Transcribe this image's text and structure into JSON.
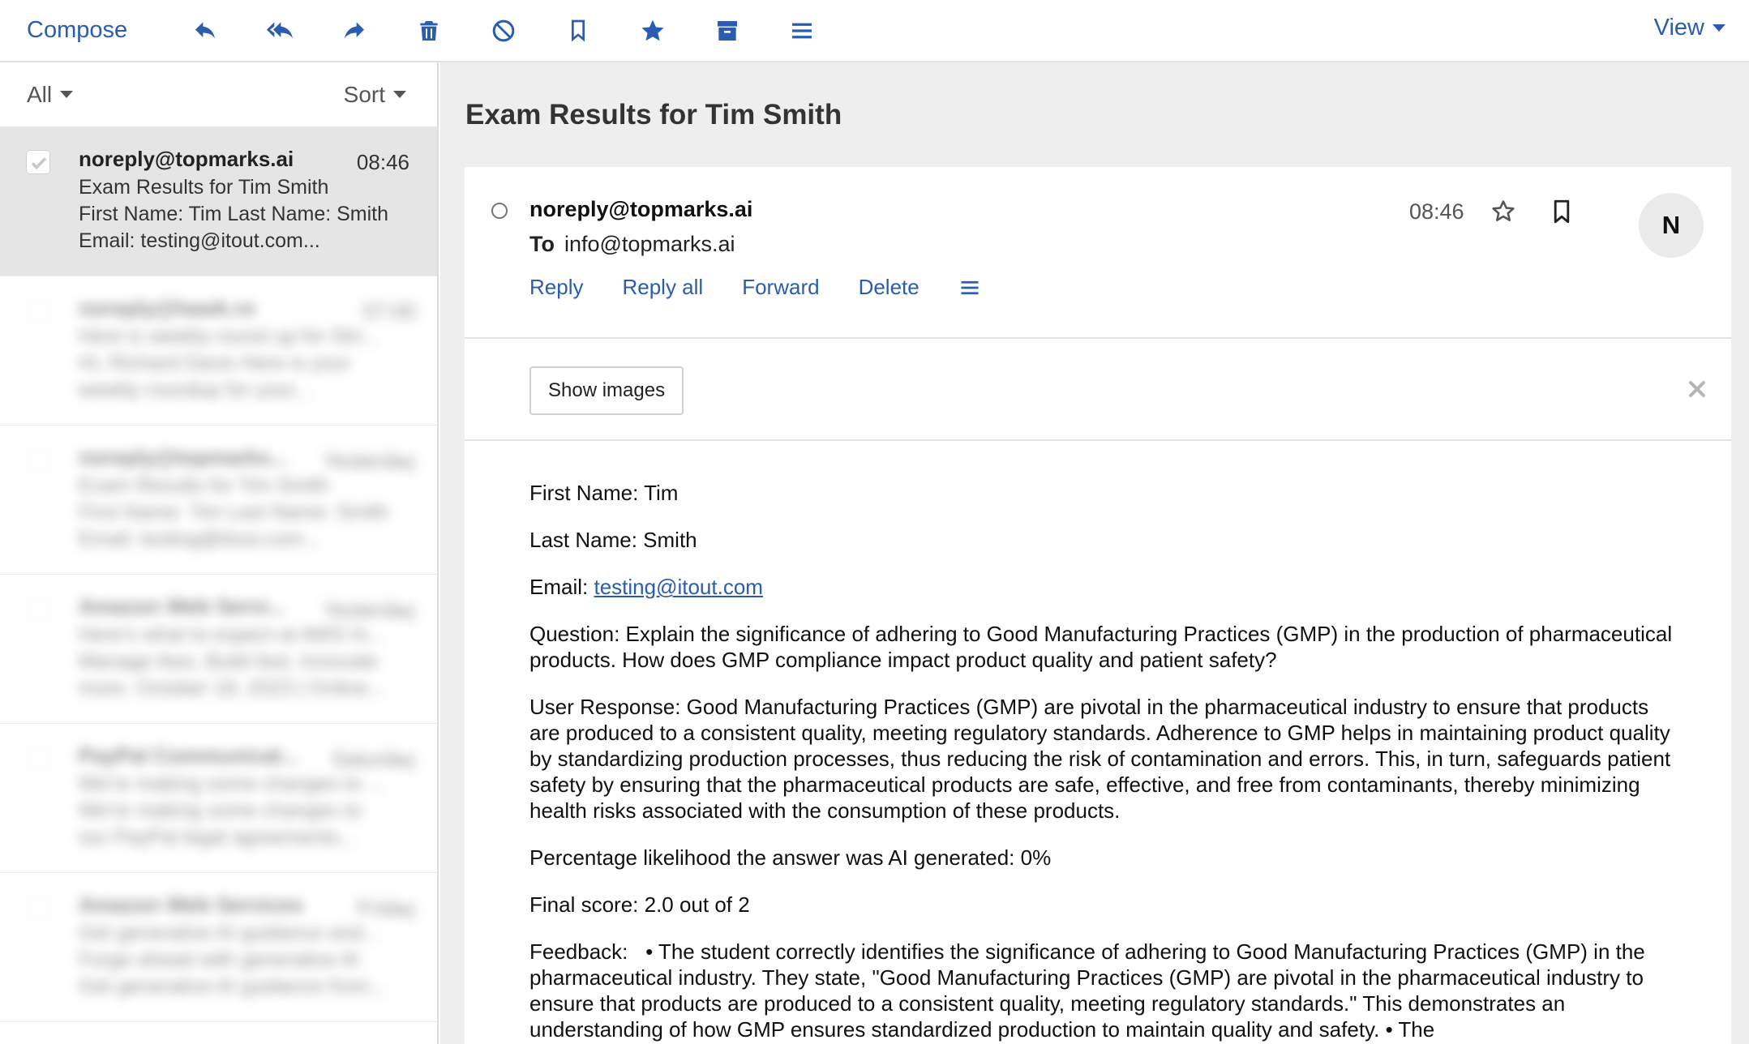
{
  "toolbar": {
    "compose_label": "Compose",
    "icons": [
      "reply-icon",
      "reply-all-icon",
      "forward-icon",
      "trash-icon",
      "block-icon",
      "bookmark-icon",
      "star-icon",
      "archive-icon",
      "menu-icon"
    ],
    "view_label": "View"
  },
  "sidebar": {
    "filter_label": "All",
    "sort_label": "Sort",
    "messages": [
      {
        "from": "noreply@topmarks.ai",
        "time": "08:46",
        "line1": "Exam Results for Tim Smith",
        "line2": "First Name: Tim Last Name: Smith",
        "line3": "Email: testing@itout.com..."
      },
      {
        "from": "noreply@hawk.ro",
        "time": "07:00",
        "line1": "Here is weekly round up for Stri...",
        "line2": "Hi, Richard Davis Here is your",
        "line3": "weekly roundup for your..."
      },
      {
        "from": "noreply@topmarks...",
        "time": "Yesterday",
        "line1": "Exam Results for Tim Smith",
        "line2": "First Name: Tim Last Name: Smith",
        "line3": "Email: testing@itout.com..."
      },
      {
        "from": "Amazon Web Servi...",
        "time": "Yesterday",
        "line1": "Here's what to expect at AWS In...",
        "line2": "Manage Aws, Build fast, Innovate",
        "line3": "more. October 18, 2023 | Online..."
      },
      {
        "from": "PayPal Communicat...",
        "time": "Saturday",
        "line1": "We're making some changes to ...",
        "line2": "We're making some changes to",
        "line3": "our PayPal legal agreements..."
      },
      {
        "from": "Amazon Web Services",
        "time": "Friday",
        "line1": "Get generative AI guidance and...",
        "line2": "Forge ahead with generative AI",
        "line3": "Get generative AI guidance from..."
      }
    ]
  },
  "email": {
    "subject": "Exam Results for Tim Smith",
    "sender": "noreply@topmarks.ai",
    "to_label": "To",
    "to": "info@topmarks.ai",
    "time": "08:46",
    "avatar_initial": "N",
    "actions": {
      "reply": "Reply",
      "reply_all": "Reply all",
      "forward": "Forward",
      "delete": "Delete"
    },
    "show_images_label": "Show images",
    "body": {
      "first_name": "First Name: Tim",
      "last_name": "Last Name: Smith",
      "email_prefix": "Email: ",
      "email_link": "testing@itout.com",
      "question": "Question: Explain the significance of adhering to Good Manufacturing Practices (GMP) in the production of pharmaceutical products. How does GMP compliance impact product quality and patient safety?",
      "user_response": "User Response: Good Manufacturing Practices (GMP) are pivotal in the pharmaceutical industry to ensure that products are produced to a consistent quality, meeting regulatory standards. Adherence to GMP helps in maintaining product quality by standardizing production processes, thus reducing the risk of contamination and errors. This, in turn, safeguards patient safety by ensuring that the pharmaceutical products are safe, effective, and free from contaminants, thereby minimizing health risks associated with the consumption of these products.",
      "ai_likelihood": "Percentage likelihood the answer was AI generated: 0%",
      "final_score": "Final score: 2.0 out of 2",
      "feedback": "Feedback:   • The student correctly identifies the significance of adhering to Good Manufacturing Practices (GMP) in the pharmaceutical industry. They state, \"Good Manufacturing Practices (GMP) are pivotal in the pharmaceutical industry to ensure that products are produced to a consistent quality, meeting regulatory standards.\" This demonstrates an understanding of how GMP ensures standardized production to maintain quality and safety. • The"
    }
  },
  "colors": {
    "accent": "#2a5db0",
    "selected_bg": "#e5e5e5",
    "pane_bg": "#eeeeee"
  }
}
